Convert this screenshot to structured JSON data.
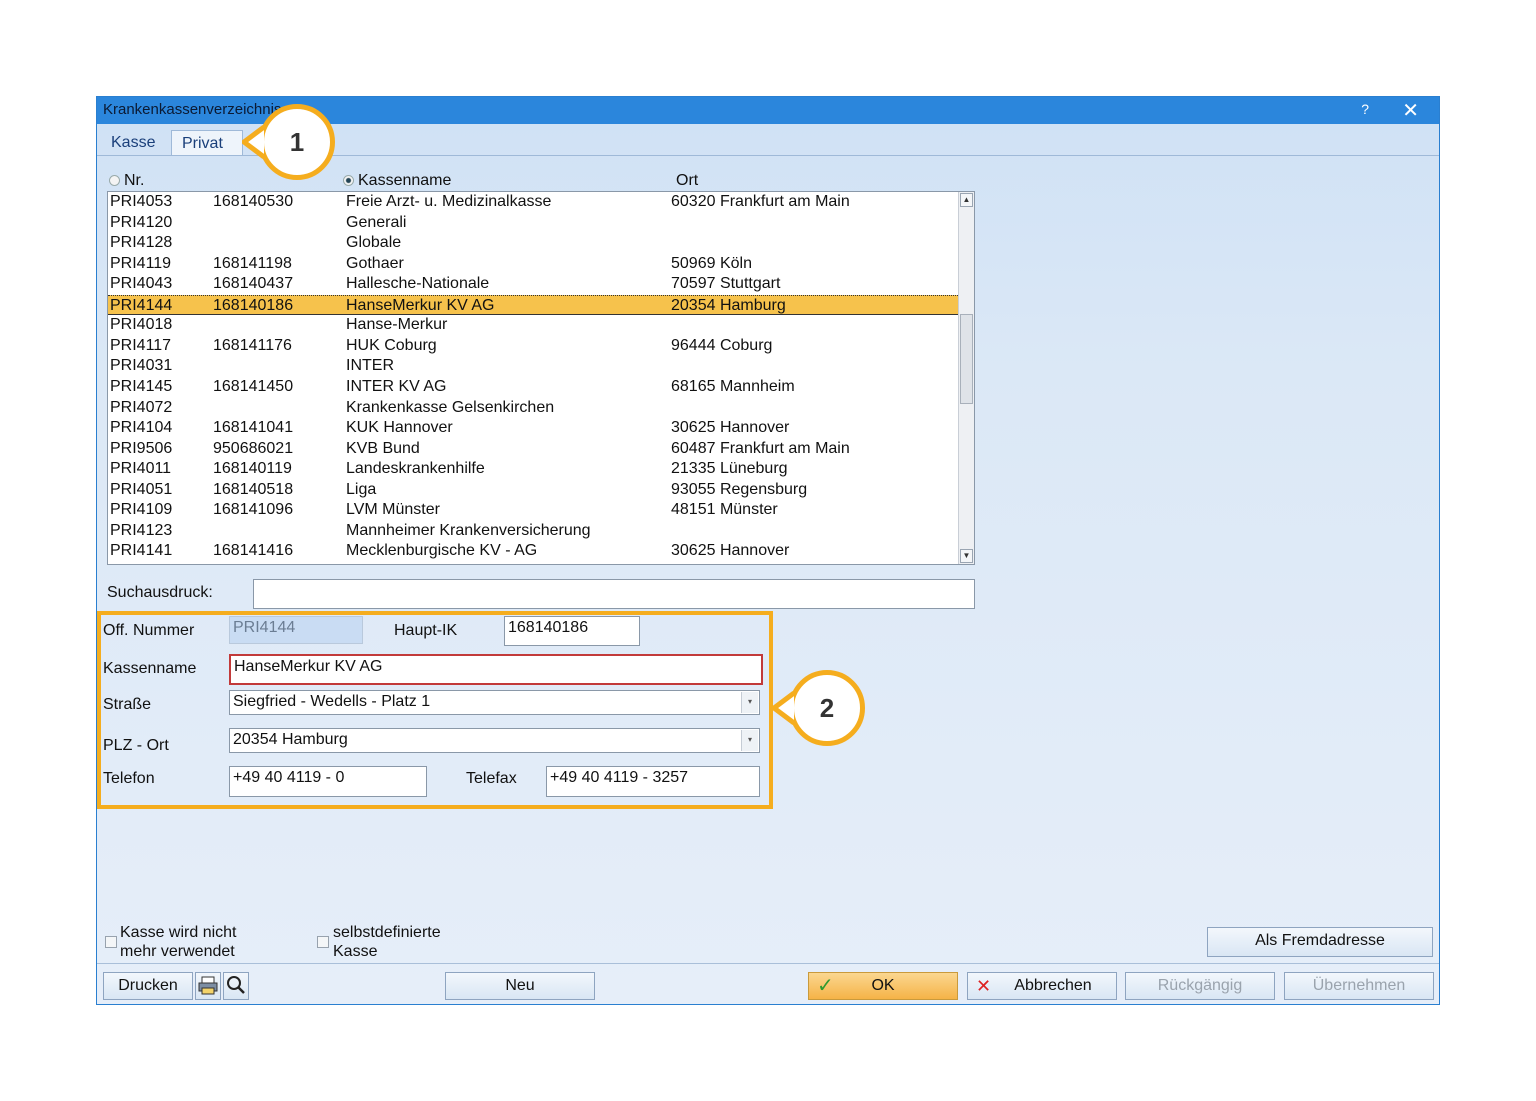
{
  "window": {
    "title": "Krankenkassenverzeichnis",
    "help": "?",
    "close": "✕"
  },
  "tabs": [
    {
      "label": "Kasse"
    },
    {
      "label": "Privat"
    }
  ],
  "columns": {
    "nr": "Nr.",
    "kassenname": "Kassenname",
    "ort": "Ort"
  },
  "rows": [
    {
      "nr": "PRI4053",
      "ik": "168140530",
      "name": "Freie Arzt- u. Medizinalkasse",
      "ort": "60320 Frankfurt am Main"
    },
    {
      "nr": "PRI4120",
      "ik": "",
      "name": "Generali",
      "ort": ""
    },
    {
      "nr": "PRI4128",
      "ik": "",
      "name": "Globale",
      "ort": ""
    },
    {
      "nr": "PRI4119",
      "ik": "168141198",
      "name": "Gothaer",
      "ort": "50969 Köln"
    },
    {
      "nr": "PRI4043",
      "ik": "168140437",
      "name": "Hallesche-Nationale",
      "ort": "70597 Stuttgart"
    },
    {
      "nr": "PRI4144",
      "ik": "168140186",
      "name": "HanseMerkur KV AG",
      "ort": "20354 Hamburg"
    },
    {
      "nr": "PRI4018",
      "ik": "",
      "name": "Hanse-Merkur",
      "ort": ""
    },
    {
      "nr": "PRI4117",
      "ik": "168141176",
      "name": "HUK Coburg",
      "ort": "96444 Coburg"
    },
    {
      "nr": "PRI4031",
      "ik": "",
      "name": "INTER",
      "ort": ""
    },
    {
      "nr": "PRI4145",
      "ik": "168141450",
      "name": "INTER KV AG",
      "ort": "68165 Mannheim"
    },
    {
      "nr": "PRI4072",
      "ik": "",
      "name": "Krankenkasse Gelsenkirchen",
      "ort": ""
    },
    {
      "nr": "PRI4104",
      "ik": "168141041",
      "name": "KUK Hannover",
      "ort": "30625 Hannover"
    },
    {
      "nr": "PRI9506",
      "ik": "950686021",
      "name": "KVB Bund",
      "ort": "60487 Frankfurt am Main"
    },
    {
      "nr": "PRI4011",
      "ik": "168140119",
      "name": "Landeskrankenhilfe",
      "ort": "21335 Lüneburg"
    },
    {
      "nr": "PRI4051",
      "ik": "168140518",
      "name": "Liga",
      "ort": "93055 Regensburg"
    },
    {
      "nr": "PRI4109",
      "ik": "168141096",
      "name": "LVM Münster",
      "ort": "48151 Münster"
    },
    {
      "nr": "PRI4123",
      "ik": "",
      "name": "Mannheimer Krankenversicherung",
      "ort": ""
    },
    {
      "nr": "PRI4141",
      "ik": "168141416",
      "name": "Mecklenburgische KV - AG",
      "ort": "30625 Hannover"
    }
  ],
  "selected_row": "PRI4144",
  "search": {
    "label": "Suchausdruck:",
    "value": ""
  },
  "detail": {
    "off_nummer_label": "Off. Nummer",
    "off_nummer": "PRI4144",
    "haupt_ik_label": "Haupt-IK",
    "haupt_ik": "168140186",
    "kassenname_label": "Kassenname",
    "kassenname": "HanseMerkur KV AG",
    "strasse_label": "Straße",
    "strasse": "Siegfried - Wedells - Platz 1",
    "plz_ort_label": "PLZ - Ort",
    "plz_ort": "20354 Hamburg",
    "telefon_label": "Telefon",
    "telefon": "+49 40 4119 - 0",
    "telefax_label": "Telefax",
    "telefax": "+49 40 4119 - 3257"
  },
  "callouts": {
    "one": "1",
    "two": "2"
  },
  "checkboxes": {
    "nicht_verwendet_line1": "Kasse wird nicht",
    "nicht_verwendet_line2": "mehr verwendet",
    "selbstdefiniert_line1": "selbstdefinierte",
    "selbstdefiniert_line2": "Kasse"
  },
  "buttons": {
    "fremdadresse": "Als Fremdadresse",
    "drucken": "Drucken",
    "neu": "Neu",
    "ok": "OK",
    "abbrechen": "Abbrechen",
    "rueckgaengig": "Rückgängig",
    "uebernehmen": "Übernehmen"
  },
  "colors": {
    "accent": "#f5ad1e",
    "titlebar": "#2b86dc",
    "selection": "#f6c24c"
  }
}
